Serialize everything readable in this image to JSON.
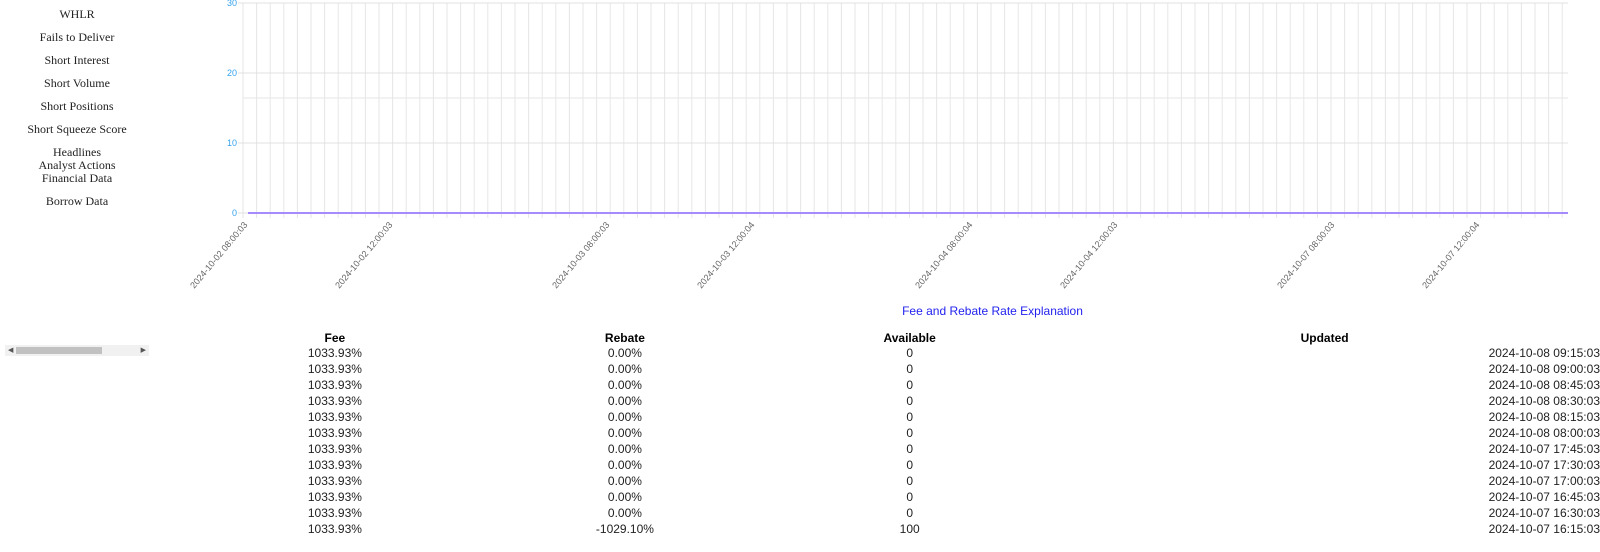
{
  "nav": {
    "items": [
      "WHLR",
      "Fails to Deliver",
      "Short Interest",
      "Short Volume",
      "Short Positions",
      "Short Squeeze Score",
      "Headlines",
      "Analyst Actions",
      "Financial Data",
      "Borrow Data"
    ]
  },
  "chart_data": {
    "type": "line",
    "ylim": [
      0,
      30
    ],
    "yticks": [
      "0",
      "10",
      "20",
      "30"
    ],
    "xticks": [
      "2024-10-02 08:00:03",
      "2024-10-02 12:00:03",
      "2024-10-03 08:00:03",
      "2024-10-03 12:00:04",
      "2024-10-04 08:00:04",
      "2024-10-04 12:00:03",
      "2024-10-07 08:00:03",
      "2024-10-07 12:00:04"
    ],
    "series": [
      {
        "values": [
          0,
          0,
          0,
          0,
          0,
          0,
          0,
          0
        ],
        "color": "#a78bfa"
      }
    ],
    "grid": true,
    "tick_color": "#36a2eb"
  },
  "explanation_link": "Fee and Rebate Rate Explanation",
  "table": {
    "headers": [
      "Fee",
      "Rebate",
      "Available",
      "Updated"
    ],
    "rows": [
      [
        "1033.93%",
        "0.00%",
        "0",
        "2024-10-08 09:15:03"
      ],
      [
        "1033.93%",
        "0.00%",
        "0",
        "2024-10-08 09:00:03"
      ],
      [
        "1033.93%",
        "0.00%",
        "0",
        "2024-10-08 08:45:03"
      ],
      [
        "1033.93%",
        "0.00%",
        "0",
        "2024-10-08 08:30:03"
      ],
      [
        "1033.93%",
        "0.00%",
        "0",
        "2024-10-08 08:15:03"
      ],
      [
        "1033.93%",
        "0.00%",
        "0",
        "2024-10-08 08:00:03"
      ],
      [
        "1033.93%",
        "0.00%",
        "0",
        "2024-10-07 17:45:03"
      ],
      [
        "1033.93%",
        "0.00%",
        "0",
        "2024-10-07 17:30:03"
      ],
      [
        "1033.93%",
        "0.00%",
        "0",
        "2024-10-07 17:00:03"
      ],
      [
        "1033.93%",
        "0.00%",
        "0",
        "2024-10-07 16:45:03"
      ],
      [
        "1033.93%",
        "0.00%",
        "0",
        "2024-10-07 16:30:03"
      ],
      [
        "1033.93%",
        "-1029.10%",
        "100",
        "2024-10-07 16:15:03"
      ]
    ]
  }
}
